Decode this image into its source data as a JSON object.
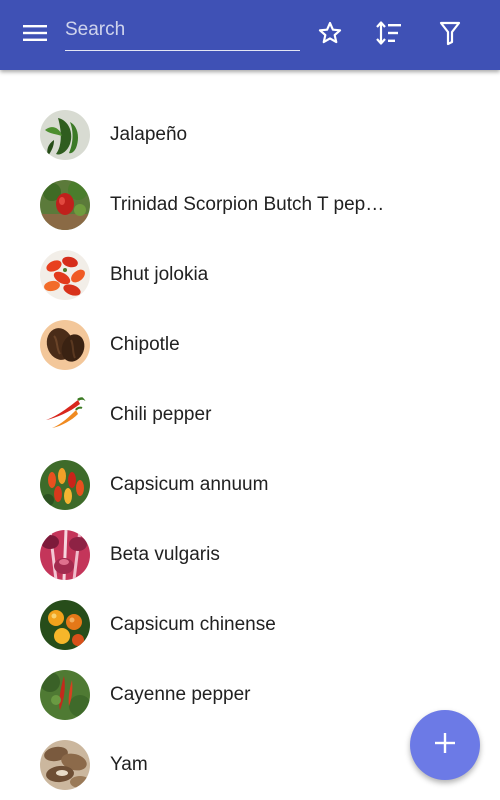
{
  "toolbar": {
    "menu_icon": "hamburger-menu-icon",
    "search_placeholder": "Search",
    "search_value": "",
    "favorite_icon": "star-outline-icon",
    "sort_icon": "sort-icon",
    "filter_icon": "filter-icon",
    "color": "#3f51b5"
  },
  "list": {
    "items": [
      {
        "label": "Jalapeño",
        "thumb": "jalapeno-photo"
      },
      {
        "label": "Trinidad Scorpion Butch T pepper",
        "thumb": "scorpion-pepper-photo"
      },
      {
        "label": "Bhut jolokia",
        "thumb": "bhut-jolokia-photo"
      },
      {
        "label": "Chipotle",
        "thumb": "chipotle-photo"
      },
      {
        "label": "Chili pepper",
        "thumb": "chili-pepper-photo"
      },
      {
        "label": "Capsicum annuum",
        "thumb": "capsicum-annuum-photo"
      },
      {
        "label": "Beta vulgaris",
        "thumb": "beta-vulgaris-photo"
      },
      {
        "label": "Capsicum chinense",
        "thumb": "capsicum-chinense-photo"
      },
      {
        "label": "Cayenne pepper",
        "thumb": "cayenne-pepper-photo"
      },
      {
        "label": "Yam",
        "thumb": "yam-photo"
      }
    ]
  },
  "fab": {
    "icon": "plus-icon",
    "color": "#6c7ae6"
  }
}
